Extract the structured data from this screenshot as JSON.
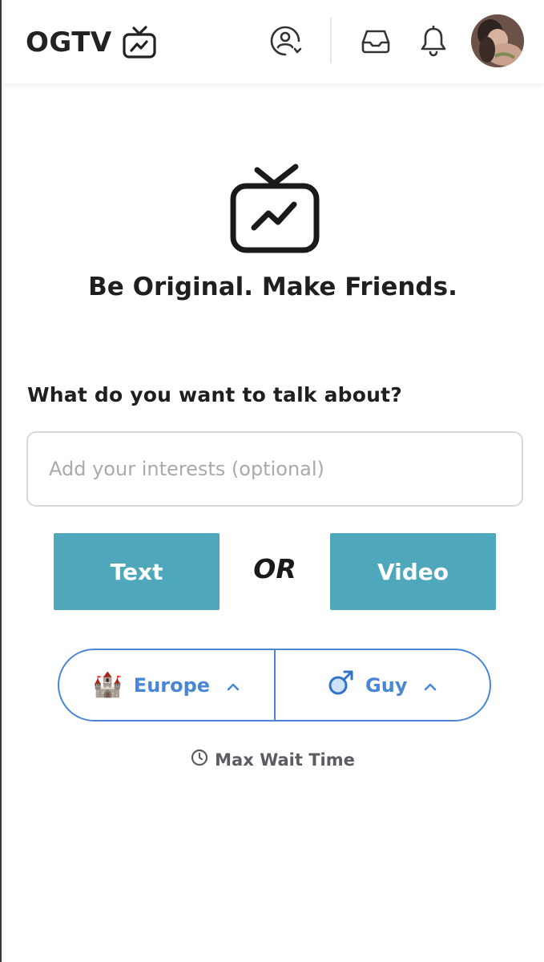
{
  "header": {
    "brand": "OGTV",
    "icons": {
      "profile": "profile-refresh-icon",
      "inbox": "inbox-icon",
      "notifications": "bell-icon"
    }
  },
  "hero": {
    "icon": "tv-trending-icon",
    "tagline": "Be Original. Make Friends."
  },
  "interests": {
    "question": "What do you want to talk about?",
    "placeholder": "Add your interests (optional)",
    "value": ""
  },
  "modes": {
    "text_label": "Text",
    "or_label": "OR",
    "video_label": "Video"
  },
  "filters": {
    "region": {
      "emoji": "🏰",
      "label": "Europe"
    },
    "gender": {
      "emoji": "♂",
      "label": "Guy"
    }
  },
  "footer": {
    "wait_label": "Max Wait Time"
  },
  "colors": {
    "accent": "#4ea7bb",
    "filter_blue": "#4a86d6",
    "text_dark": "#1f1f1f",
    "muted": "#5c5c62"
  }
}
